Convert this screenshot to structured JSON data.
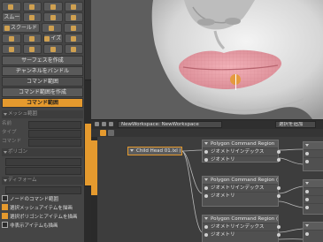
{
  "left_panel": {
    "tool_rows": [
      [
        "",
        "",
        "",
        ""
      ],
      [
        "スムース",
        "",
        "",
        ""
      ],
      [
        "スクールド",
        "",
        "",
        ""
      ],
      [
        "",
        "",
        "イズ",
        ""
      ],
      [
        "",
        "",
        "",
        ""
      ]
    ],
    "row_buttons": [
      {
        "label": "サーフェスを作成"
      },
      {
        "label": "",
        "orange": false
      },
      {
        "label": "ヂャンネルをバンドル"
      },
      {
        "label": "コマンド範囲"
      },
      {
        "label": "コマンド範囲を作成"
      },
      {
        "label": "コマンド範囲",
        "orange": true
      }
    ],
    "sections": [
      {
        "label": "メッシュ範囲"
      },
      {
        "label": "ポリゴン"
      },
      {
        "label": "ディフォーム"
      }
    ],
    "fields": [
      {
        "label": "名前"
      },
      {
        "label": "タイプ"
      },
      {
        "label": "コマンド"
      }
    ],
    "checks": [
      {
        "label": "ノードのコマンド範囲",
        "on": false
      },
      {
        "label": "選択メッシュアイテムを描画",
        "on": true
      },
      {
        "label": "選択ポリゴンとアイテムを描画",
        "on": true
      },
      {
        "label": "非表示アイテムも描画",
        "on": false
      }
    ]
  },
  "node_editor": {
    "tabs": [
      "NewWorkspace: NewWorkspace",
      "選択を追加"
    ],
    "nodes": [
      {
        "title": "Child Head 01.lxl (2)",
        "ports": []
      },
      {
        "title": "Polygon Command Region",
        "ports": [
          "ジオメトリインデックス",
          "ジオメトリ"
        ]
      },
      {
        "title": "Polygon Command Region (2)",
        "ports": [
          "ジオメトリインデックス",
          "ジオメトリ"
        ]
      },
      {
        "title": "Polygon Command Region (3)",
        "ports": [
          "ジオメトリインデックス",
          "ジオメトリ"
        ]
      },
      {
        "title": "",
        "ports": [
          "",
          "",
          ""
        ]
      },
      {
        "title": "",
        "ports": [
          "",
          "",
          ""
        ]
      }
    ],
    "right_node_labels": [
      "Nonce",
      "Nonce",
      "Nonce"
    ]
  },
  "colors": {
    "accent": "#e59a2e",
    "lip_highlight": "#e8a0a8"
  }
}
